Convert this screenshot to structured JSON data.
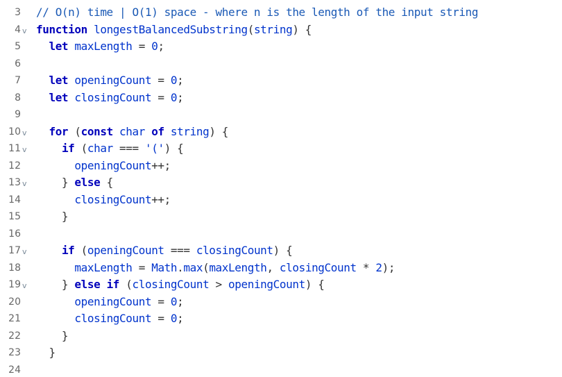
{
  "editor": {
    "lines": [
      {
        "n": "3",
        "fold": false,
        "tokens": [
          {
            "t": "// O(n) time | O(1) space - where n is the length of the input string",
            "c": "cm"
          }
        ]
      },
      {
        "n": "4",
        "fold": true,
        "tokens": [
          {
            "t": "function",
            "c": "kw"
          },
          {
            "t": " ",
            "c": "pl"
          },
          {
            "t": "longestBalancedSubstring",
            "c": "fn"
          },
          {
            "t": "(",
            "c": "pl"
          },
          {
            "t": "string",
            "c": "id"
          },
          {
            "t": ") {",
            "c": "pl"
          }
        ]
      },
      {
        "n": "5",
        "fold": false,
        "tokens": [
          {
            "t": "  ",
            "c": "pl"
          },
          {
            "t": "let",
            "c": "kw"
          },
          {
            "t": " ",
            "c": "pl"
          },
          {
            "t": "maxLength",
            "c": "id"
          },
          {
            "t": " = ",
            "c": "op"
          },
          {
            "t": "0",
            "c": "num"
          },
          {
            "t": ";",
            "c": "pl"
          }
        ]
      },
      {
        "n": "6",
        "fold": false,
        "tokens": []
      },
      {
        "n": "7",
        "fold": false,
        "tokens": [
          {
            "t": "  ",
            "c": "pl"
          },
          {
            "t": "let",
            "c": "kw"
          },
          {
            "t": " ",
            "c": "pl"
          },
          {
            "t": "openingCount",
            "c": "id"
          },
          {
            "t": " = ",
            "c": "op"
          },
          {
            "t": "0",
            "c": "num"
          },
          {
            "t": ";",
            "c": "pl"
          }
        ]
      },
      {
        "n": "8",
        "fold": false,
        "tokens": [
          {
            "t": "  ",
            "c": "pl"
          },
          {
            "t": "let",
            "c": "kw"
          },
          {
            "t": " ",
            "c": "pl"
          },
          {
            "t": "closingCount",
            "c": "id"
          },
          {
            "t": " = ",
            "c": "op"
          },
          {
            "t": "0",
            "c": "num"
          },
          {
            "t": ";",
            "c": "pl"
          }
        ]
      },
      {
        "n": "9",
        "fold": false,
        "tokens": []
      },
      {
        "n": "10",
        "fold": true,
        "tokens": [
          {
            "t": "  ",
            "c": "pl"
          },
          {
            "t": "for",
            "c": "kw"
          },
          {
            "t": " (",
            "c": "pl"
          },
          {
            "t": "const",
            "c": "kw"
          },
          {
            "t": " ",
            "c": "pl"
          },
          {
            "t": "char",
            "c": "id"
          },
          {
            "t": " ",
            "c": "pl"
          },
          {
            "t": "of",
            "c": "kw"
          },
          {
            "t": " ",
            "c": "pl"
          },
          {
            "t": "string",
            "c": "id"
          },
          {
            "t": ") {",
            "c": "pl"
          }
        ]
      },
      {
        "n": "11",
        "fold": true,
        "tokens": [
          {
            "t": "    ",
            "c": "pl"
          },
          {
            "t": "if",
            "c": "kw"
          },
          {
            "t": " (",
            "c": "pl"
          },
          {
            "t": "char",
            "c": "id"
          },
          {
            "t": " === ",
            "c": "op"
          },
          {
            "t": "'('",
            "c": "str"
          },
          {
            "t": ") {",
            "c": "pl"
          }
        ]
      },
      {
        "n": "12",
        "fold": false,
        "tokens": [
          {
            "t": "      ",
            "c": "pl"
          },
          {
            "t": "openingCount",
            "c": "id"
          },
          {
            "t": "++;",
            "c": "pl"
          }
        ]
      },
      {
        "n": "13",
        "fold": true,
        "tokens": [
          {
            "t": "    } ",
            "c": "pl"
          },
          {
            "t": "else",
            "c": "kw"
          },
          {
            "t": " {",
            "c": "pl"
          }
        ]
      },
      {
        "n": "14",
        "fold": false,
        "tokens": [
          {
            "t": "      ",
            "c": "pl"
          },
          {
            "t": "closingCount",
            "c": "id"
          },
          {
            "t": "++;",
            "c": "pl"
          }
        ]
      },
      {
        "n": "15",
        "fold": false,
        "tokens": [
          {
            "t": "    }",
            "c": "pl"
          }
        ]
      },
      {
        "n": "16",
        "fold": false,
        "tokens": []
      },
      {
        "n": "17",
        "fold": true,
        "tokens": [
          {
            "t": "    ",
            "c": "pl"
          },
          {
            "t": "if",
            "c": "kw"
          },
          {
            "t": " (",
            "c": "pl"
          },
          {
            "t": "openingCount",
            "c": "id"
          },
          {
            "t": " === ",
            "c": "op"
          },
          {
            "t": "closingCount",
            "c": "id"
          },
          {
            "t": ") {",
            "c": "pl"
          }
        ]
      },
      {
        "n": "18",
        "fold": false,
        "tokens": [
          {
            "t": "      ",
            "c": "pl"
          },
          {
            "t": "maxLength",
            "c": "id"
          },
          {
            "t": " = ",
            "c": "op"
          },
          {
            "t": "Math",
            "c": "id"
          },
          {
            "t": ".",
            "c": "pl"
          },
          {
            "t": "max",
            "c": "id"
          },
          {
            "t": "(",
            "c": "pl"
          },
          {
            "t": "maxLength",
            "c": "id"
          },
          {
            "t": ", ",
            "c": "pl"
          },
          {
            "t": "closingCount",
            "c": "id"
          },
          {
            "t": " * ",
            "c": "op"
          },
          {
            "t": "2",
            "c": "num"
          },
          {
            "t": ");",
            "c": "pl"
          }
        ]
      },
      {
        "n": "19",
        "fold": true,
        "tokens": [
          {
            "t": "    } ",
            "c": "pl"
          },
          {
            "t": "else",
            "c": "kw"
          },
          {
            "t": " ",
            "c": "pl"
          },
          {
            "t": "if",
            "c": "kw"
          },
          {
            "t": " (",
            "c": "pl"
          },
          {
            "t": "closingCount",
            "c": "id"
          },
          {
            "t": " > ",
            "c": "op"
          },
          {
            "t": "openingCount",
            "c": "id"
          },
          {
            "t": ") {",
            "c": "pl"
          }
        ]
      },
      {
        "n": "20",
        "fold": false,
        "tokens": [
          {
            "t": "      ",
            "c": "pl"
          },
          {
            "t": "openingCount",
            "c": "id"
          },
          {
            "t": " = ",
            "c": "op"
          },
          {
            "t": "0",
            "c": "num"
          },
          {
            "t": ";",
            "c": "pl"
          }
        ]
      },
      {
        "n": "21",
        "fold": false,
        "tokens": [
          {
            "t": "      ",
            "c": "pl"
          },
          {
            "t": "closingCount",
            "c": "id"
          },
          {
            "t": " = ",
            "c": "op"
          },
          {
            "t": "0",
            "c": "num"
          },
          {
            "t": ";",
            "c": "pl"
          }
        ]
      },
      {
        "n": "22",
        "fold": false,
        "tokens": [
          {
            "t": "    }",
            "c": "pl"
          }
        ]
      },
      {
        "n": "23",
        "fold": false,
        "tokens": [
          {
            "t": "  }",
            "c": "pl"
          }
        ]
      },
      {
        "n": "24",
        "fold": false,
        "tokens": []
      }
    ],
    "fold_glyph": "v",
    "colors": {
      "keyword": "#0000bb",
      "identifier": "#0033cc",
      "comment": "#1a59b5",
      "line_number": "#666666",
      "background": "#ffffff"
    }
  }
}
